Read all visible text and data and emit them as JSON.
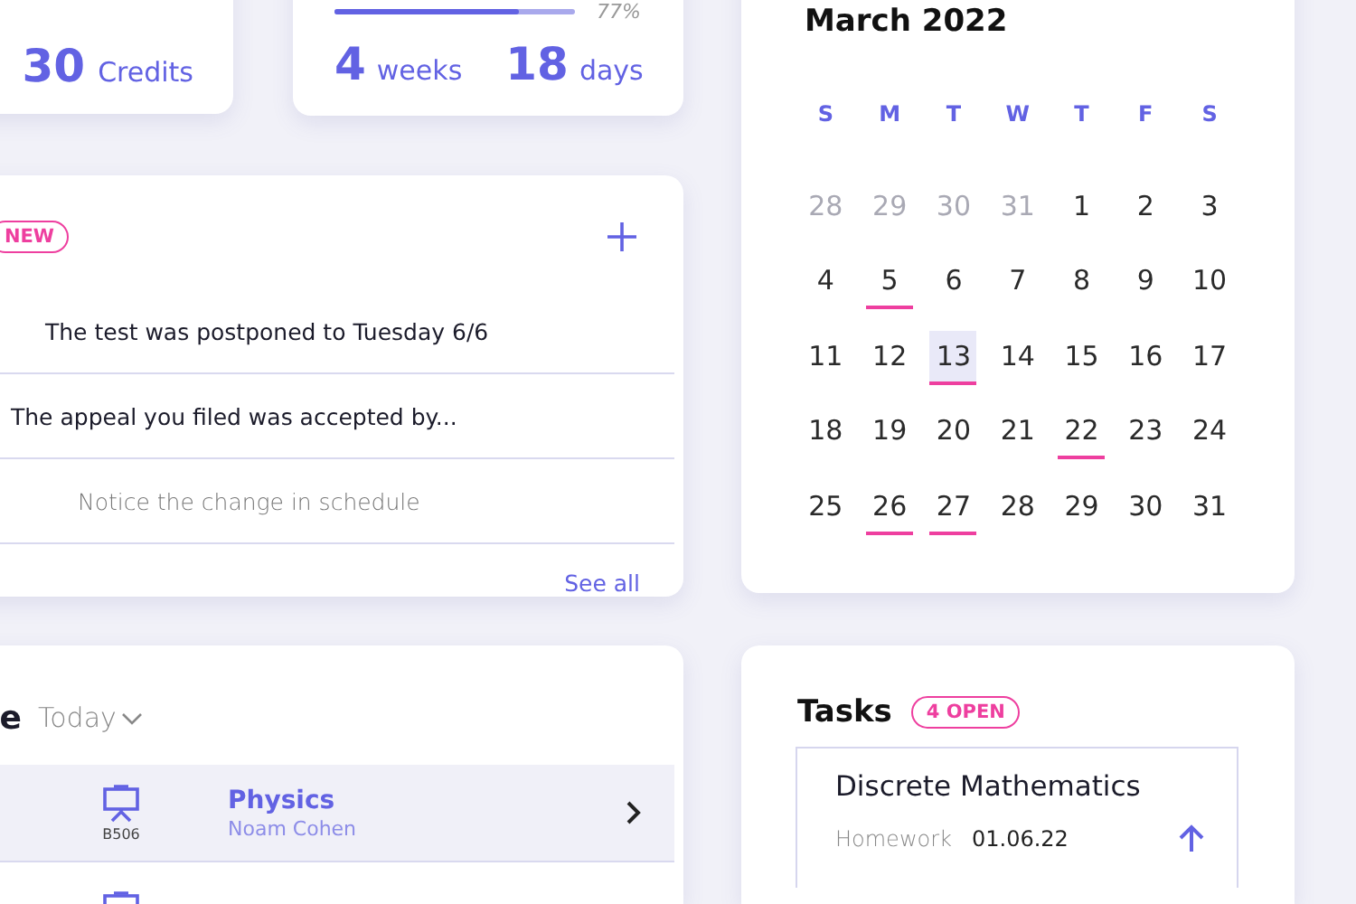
{
  "credits_card": {
    "value": "30",
    "unit": "Credits"
  },
  "progress_card": {
    "level": 0.77,
    "percent": "77%",
    "weeks_value": "4",
    "weeks_unit": "weeks",
    "days_value": "18",
    "days_unit": "days"
  },
  "notifications": {
    "badge": "NEW",
    "items": [
      {
        "text": "The test was postponed to Tuesday 6/6",
        "read": false
      },
      {
        "text": "The appeal you filed was accepted by...",
        "read": false
      },
      {
        "text": "Notice the change in schedule",
        "read": true
      }
    ],
    "see_all": "See all"
  },
  "schedule": {
    "title": "e",
    "filter": "Today",
    "lessons": [
      {
        "room": "B506",
        "name": "Physics",
        "teacher": "Noam Cohen",
        "selected": true
      },
      {
        "selected": false
      }
    ]
  },
  "calendar": {
    "title": "March 2022",
    "weekdays": [
      "S",
      "M",
      "T",
      "W",
      "T",
      "F",
      "S"
    ],
    "days": [
      {
        "label": "28",
        "outside": true,
        "today": false,
        "event": false
      },
      {
        "label": "29",
        "outside": true,
        "today": false,
        "event": false
      },
      {
        "label": "30",
        "outside": true,
        "today": false,
        "event": false
      },
      {
        "label": "31",
        "outside": true,
        "today": false,
        "event": false
      },
      {
        "label": "1",
        "outside": false,
        "today": false,
        "event": false
      },
      {
        "label": "2",
        "outside": false,
        "today": false,
        "event": false
      },
      {
        "label": "3",
        "outside": false,
        "today": false,
        "event": false
      },
      {
        "label": "4",
        "outside": false,
        "today": false,
        "event": false
      },
      {
        "label": "5",
        "outside": false,
        "today": false,
        "event": true
      },
      {
        "label": "6",
        "outside": false,
        "today": false,
        "event": false
      },
      {
        "label": "7",
        "outside": false,
        "today": false,
        "event": false
      },
      {
        "label": "8",
        "outside": false,
        "today": false,
        "event": false
      },
      {
        "label": "9",
        "outside": false,
        "today": false,
        "event": false
      },
      {
        "label": "10",
        "outside": false,
        "today": false,
        "event": false
      },
      {
        "label": "11",
        "outside": false,
        "today": false,
        "event": false
      },
      {
        "label": "12",
        "outside": false,
        "today": false,
        "event": false
      },
      {
        "label": "13",
        "outside": false,
        "today": true,
        "event": true
      },
      {
        "label": "14",
        "outside": false,
        "today": false,
        "event": false
      },
      {
        "label": "15",
        "outside": false,
        "today": false,
        "event": false
      },
      {
        "label": "16",
        "outside": false,
        "today": false,
        "event": false
      },
      {
        "label": "17",
        "outside": false,
        "today": false,
        "event": false
      },
      {
        "label": "18",
        "outside": false,
        "today": false,
        "event": false
      },
      {
        "label": "19",
        "outside": false,
        "today": false,
        "event": false
      },
      {
        "label": "20",
        "outside": false,
        "today": false,
        "event": false
      },
      {
        "label": "21",
        "outside": false,
        "today": false,
        "event": false
      },
      {
        "label": "22",
        "outside": false,
        "today": false,
        "event": true
      },
      {
        "label": "23",
        "outside": false,
        "today": false,
        "event": false
      },
      {
        "label": "24",
        "outside": false,
        "today": false,
        "event": false
      },
      {
        "label": "25",
        "outside": false,
        "today": false,
        "event": false
      },
      {
        "label": "26",
        "outside": false,
        "today": false,
        "event": true
      },
      {
        "label": "27",
        "outside": false,
        "today": false,
        "event": true
      },
      {
        "label": "28",
        "outside": false,
        "today": false,
        "event": false
      },
      {
        "label": "29",
        "outside": false,
        "today": false,
        "event": false
      },
      {
        "label": "30",
        "outside": false,
        "today": false,
        "event": false
      },
      {
        "label": "31",
        "outside": false,
        "today": false,
        "event": false
      }
    ]
  },
  "tasks": {
    "title": "Tasks",
    "badge": "4 OPEN",
    "items": [
      {
        "title": "Discrete Mathematics",
        "type": "Homework",
        "date": "01.06.22"
      }
    ]
  }
}
